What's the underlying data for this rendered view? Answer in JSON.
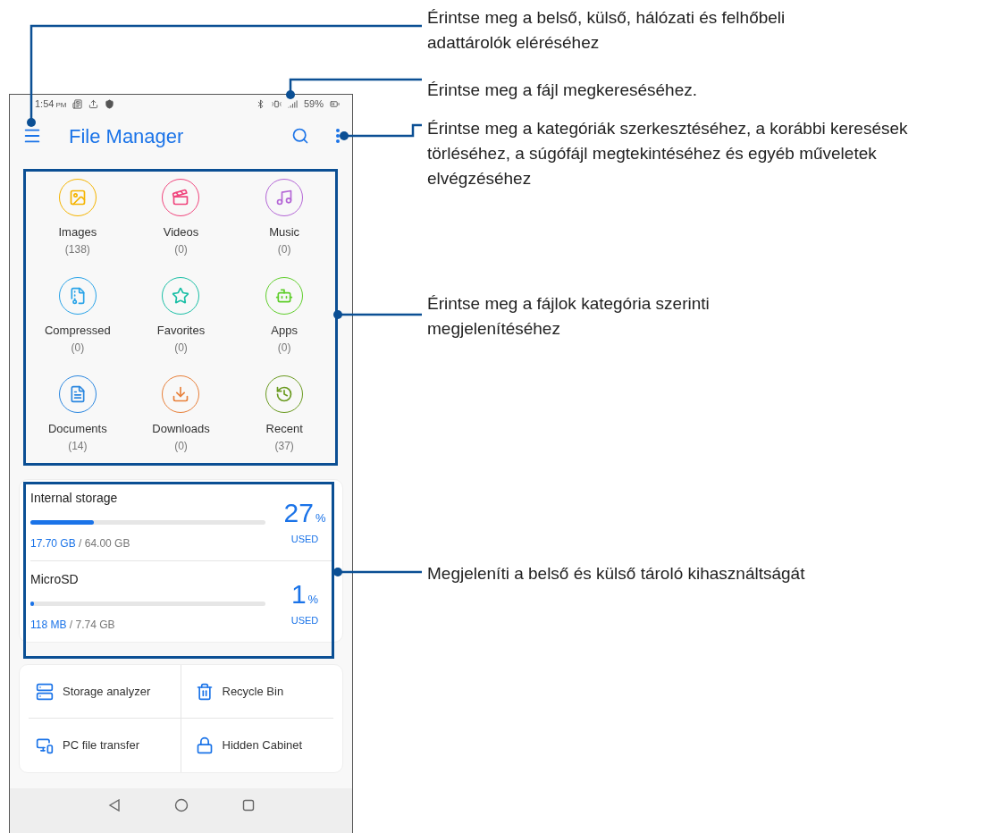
{
  "status_bar": {
    "time": "1:54",
    "ampm": "PM",
    "battery": "59%"
  },
  "app_bar": {
    "title": "File Manager"
  },
  "categories": [
    {
      "label": "Images",
      "count": "(138)",
      "color": "#f5b400"
    },
    {
      "label": "Videos",
      "count": "(0)",
      "color": "#f0457d"
    },
    {
      "label": "Music",
      "count": "(0)",
      "color": "#b466d6"
    },
    {
      "label": "Compressed",
      "count": "(0)",
      "color": "#29a3e8"
    },
    {
      "label": "Favorites",
      "count": "(0)",
      "color": "#1bbfa6"
    },
    {
      "label": "Apps",
      "count": "(0)",
      "color": "#5fce2b"
    },
    {
      "label": "Documents",
      "count": "(14)",
      "color": "#2b87e0"
    },
    {
      "label": "Downloads",
      "count": "(0)",
      "color": "#e8803a"
    },
    {
      "label": "Recent",
      "count": "(37)",
      "color": "#6a9a1f"
    }
  ],
  "storage": [
    {
      "name": "Internal storage",
      "used": "17.70 GB",
      "total": "/ 64.00 GB",
      "percent": "27",
      "unit": "%",
      "used_label": "USED",
      "level": 0.27
    },
    {
      "name": "MicroSD",
      "used": "118 MB",
      "total": "/ 7.74 GB",
      "percent": "1",
      "unit": "%",
      "used_label": "USED",
      "level": 0.015
    }
  ],
  "tools": [
    {
      "label": "Storage analyzer"
    },
    {
      "label": "Recycle Bin"
    },
    {
      "label": "PC file transfer"
    },
    {
      "label": "Hidden Cabinet"
    }
  ],
  "callouts": [
    {
      "text": "Érintse meg a belső, külső, hálózati és felhőbeli adattárolók eléréséhez"
    },
    {
      "text": "Érintse meg a fájl megkereséséhez."
    },
    {
      "text": "Érintse meg a kategóriák szerkesztéséhez, a korábbi keresések törléséhez, a súgófájl megtekintéséhez és egyéb műveletek elvégzéséhez"
    },
    {
      "text": "Érintse meg a fájlok kategória szerinti megjelenítéséhez"
    },
    {
      "text": "Megjeleníti a belső és külső tároló kihasználtságát"
    }
  ]
}
